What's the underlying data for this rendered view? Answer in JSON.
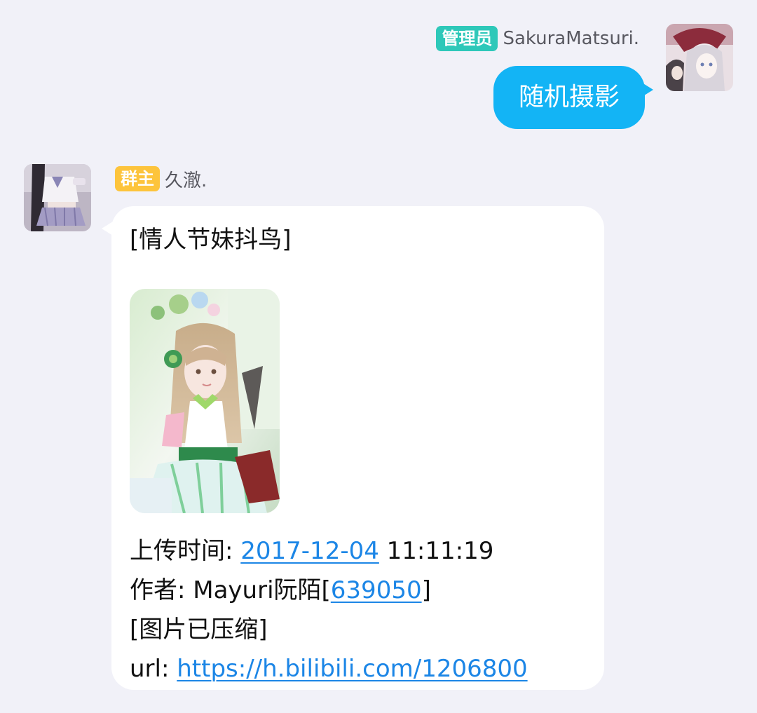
{
  "outgoing": {
    "badge": "管理员",
    "sender": "SakuraMatsuri.",
    "text": "随机摄影",
    "badge_color": "#2ec8b9",
    "bubble_color": "#13b4f5"
  },
  "incoming": {
    "badge": "群主",
    "sender": "久澈.",
    "badge_color": "#fdc43c",
    "card": {
      "title": "[情人节妹抖鸟]",
      "upload_label": "上传时间: ",
      "upload_date": "2017-12-04",
      "upload_time": " 11:11:19",
      "author_label": "作者: Mayuri阮陌[",
      "author_id": "639050",
      "author_close": "]",
      "compressed_note": "[图片已压缩]",
      "url_label": "url: ",
      "url": "https://h.bilibili.com/1206800"
    },
    "link_color": "#1c86e6"
  }
}
